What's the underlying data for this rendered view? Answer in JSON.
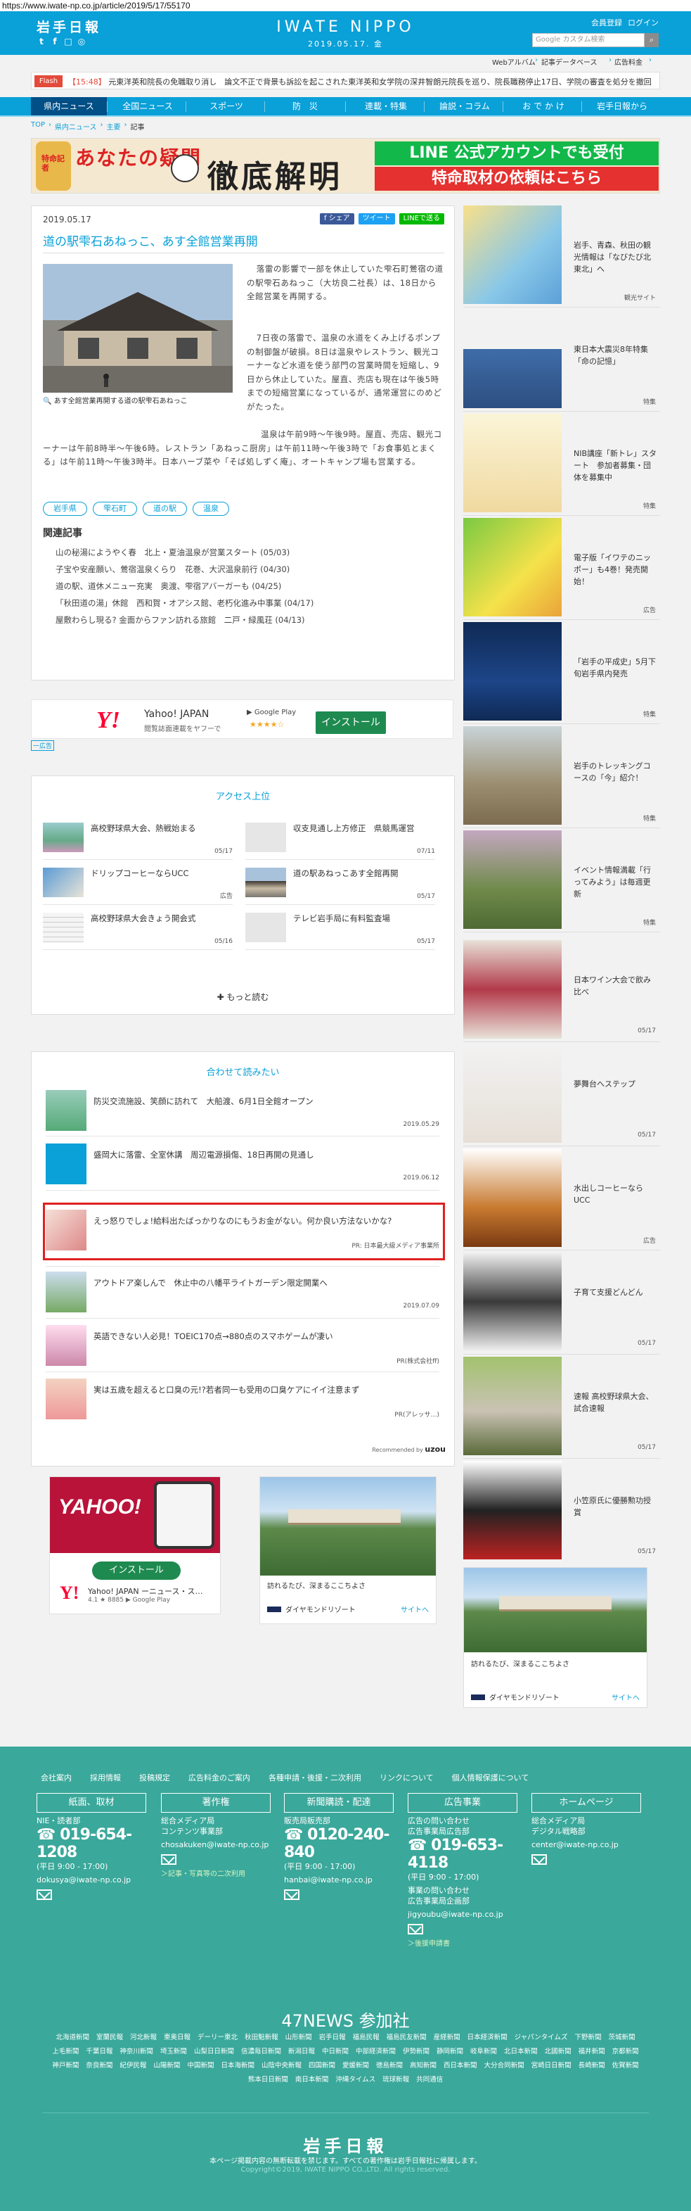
{
  "url": "https://www.iwate-np.co.jp/article/2019/5/17/55170",
  "header": {
    "logo": "岩手日報",
    "brand": "IWATE NIPPO",
    "date": "2019.05.17. 金",
    "register": "会員登録",
    "login": "ログイン",
    "search_placeholder": "Google カスタム検索",
    "social_icons": [
      "twitter-icon",
      "facebook-icon",
      "line-icon",
      "instagram-icon"
    ]
  },
  "subnav": {
    "items": [
      "Webアルバム",
      "記事データベース",
      "広告料金"
    ],
    "arrow": "›"
  },
  "flash": {
    "tag": "Flash",
    "time": "【15:48】",
    "text": "元東洋英和院長の免職取り消し　論文不正で背景も訴訟を起こされた東洋英和女学院の深井智朗元院長を巡り、院長職務停止17日、学院の審査を処分を撤回した"
  },
  "nav": {
    "items": [
      "県内ニュース",
      "全国ニュース",
      "スポーツ",
      "防　災",
      "連載・特集",
      "論説・コラム",
      "お で か け",
      "岩手日報から"
    ]
  },
  "breadcrumb": [
    "TOP",
    "県内ニュース",
    "主要",
    "記事"
  ],
  "banner": {
    "title1": "特命記者",
    "title2": "あなたの疑問",
    "title3": "徹底解明",
    "line1": "LINE 公式アカウントでも受付",
    "line2": "特命取材の依頼はこちら"
  },
  "article": {
    "date": "2019.05.17",
    "share": [
      "f シェア",
      "ツイート",
      "LINEで送る"
    ],
    "title": "道の駅雫石あねっこ、あす全館営業再開",
    "caption": "あす全館営業再開する道の駅雫石あねっこ",
    "paragraphs": [
      "落雷の影響で一部を休止していた雫石町鶯宿の道の駅雫石あねっこ（大坊良二社長）は、18日から全館営業を再開する。",
      "7日夜の落雷で、温泉の水道をくみ上げるポンプの制御盤が破損。8日は温泉やレストラン、観光コーナーなど水道を使う部門の営業時間を短縮し、9日から休止していた。屋直、売店も現在は午後5時までの短縮営業になっているが、通常運営にのめどがたった。",
      "温泉は午前9時〜午後9時。屋直、売店、観光コーナーは午前8時半〜午後6時。レストラン「あねっこ厨房」は午前11時〜午後3時で「お食事処とまくる」は午前11時〜午後3時半。日本ハーブ菜や「そば処しずく庵」、オートキャンプ場も営業する。"
    ],
    "tags": [
      "岩手県",
      "雫石町",
      "道の駅",
      "温泉"
    ],
    "related_heading": "関連記事",
    "related": [
      "山の秘湯にようやく春　北上・夏油温泉が営業スタート (05/03)",
      "子宝や安産願い、鶯宿温泉くらり　花巻、大沢温泉前行 (04/30)",
      "道の駅、道休メニュー充実　奥渡、雫宿アバーガーも (04/25)",
      "「秋田道の湯」休館　西和賀・オアシス館、老朽化進み中事業 (04/17)",
      "屋敷わらし現る? 金面からファン訪れる旅館　二戸・緑風荘 (04/13)"
    ]
  },
  "yahoo_ad": {
    "brand": "Yahoo! JAPAN",
    "sub": "閲覧誌面連載をヤフーで",
    "store": "Google Play",
    "stars": "★★★★☆",
    "install": "インストール",
    "label": "一広告"
  },
  "access": {
    "title": "アクセス上位",
    "items": [
      {
        "title": "高校野球県大会、熱戦始まる",
        "date": "05/17"
      },
      {
        "title": "収支見通し上方修正　県競馬運営",
        "date": "07/11"
      },
      {
        "title": "ドリップコーヒーならUCC",
        "date": "広告"
      },
      {
        "title": "道の駅あねっこあす全館再開",
        "date": "05/17"
      },
      {
        "title": "高校野球県大会きょう開会式",
        "date": "05/16"
      },
      {
        "title": "テレビ岩手局に有料監査場",
        "date": "05/17"
      }
    ],
    "more": "✚ もっと読む"
  },
  "recommend": {
    "title": "合わせて読みたい",
    "items": [
      {
        "title": "防災交流施設、笑顔に訪れて　大船渡、6月1日全館オープン",
        "date": "2019.05.29"
      },
      {
        "title": "盛岡大に落雷、全室休講　周辺電源損傷、18日再開の見通し",
        "date": "2019.06.12"
      },
      {
        "title": "えっ怒りでしょ!給料出たばっかりなのにもうお金がない。何か良い方法ないかな?",
        "date": "PR: 日本最大級メディア事業所"
      },
      {
        "title": "アウトドア楽しんで　休止中の八幡平ライトガーデン限定開業へ",
        "date": "2019.07.09"
      },
      {
        "title": "英語できない人必見！TOEIC170点→880点のスマホゲームが凄い",
        "date": "PR(株式会社ff)"
      },
      {
        "title": "実は五歳を超えると口臭の元!?若者同一も受用の口臭ケアにイイ注意まず",
        "date": "PR(アレッサ…)"
      }
    ],
    "credit": "Recommended by",
    "credit_brand": "uzou"
  },
  "bottom_ads": {
    "yahoo": {
      "img": "YAHOO!",
      "install": "インストール",
      "title": "Yahoo! JAPAN ーニュース・ス…",
      "sub": "4.1 ★ 8885  ▶ Google Play",
      "y": "Y!"
    },
    "diamond": {
      "txt": "訪れるたび、深まるここちよさ",
      "logo": "ダイヤモンドリゾート",
      "link": "サイトへ"
    }
  },
  "sidebar": [
    {
      "title": "岩手、青森、秋田の観光情報は「なびたび北東北」へ",
      "date": "観光サイト"
    },
    {
      "title": "東日本大震災8年特集「命の記憶」",
      "date": "特集"
    },
    {
      "title": "NIB講座「新トレ」スタート　参加者募集・団体を募集中",
      "date": "特集"
    },
    {
      "title": "電子版「イワテのニッポー」も4巻！発売開始！",
      "date": "広告"
    },
    {
      "title": "「岩手の平成史」5月下旬岩手県内発売",
      "date": "特集"
    },
    {
      "title": "岩手のトレッキングコースの「今」紹介！",
      "date": "特集"
    },
    {
      "title": "イベント情報満載「行ってみよう」は毎週更新",
      "date": "特集"
    },
    {
      "title": "日本ワイン大会で飲み比べ",
      "date": "05/17"
    },
    {
      "title": "夢舞台へステップ",
      "date": "05/17"
    },
    {
      "title": "水出しコーヒーならUCC",
      "date": "広告"
    },
    {
      "title": "子育て支援どんどん",
      "date": "05/17"
    },
    {
      "title": "速報 高校野球県大会、試合速報",
      "date": "05/17"
    },
    {
      "title": "小笠原氏に優勝勲功授賞",
      "date": "05/17"
    }
  ],
  "side_ad": {
    "txt": "訪れるたび、深まるここちよさ",
    "logo": "ダイヤモンドリゾート",
    "link": "サイトへ"
  },
  "footer": {
    "links": [
      "会社案内",
      "採用情報",
      "投稿規定",
      "広告料金のご案内",
      "各種申請・後援・二次利用",
      "リンクについて",
      "個人情報保護について"
    ],
    "boxes": [
      {
        "head": "紙面、取材",
        "lines": [
          "NIE・読者部"
        ],
        "big": "☎ 019-654-1208",
        "hours": "(平日 9:00 - 17:00)",
        "mail": "dokusya@iwate-np.co.jp",
        "extra": ""
      },
      {
        "head": "著作権",
        "lines": [
          "総合メディア局",
          "コンテンツ事業部"
        ],
        "big": "",
        "hours": "",
        "mail": "chosakuken@iwate-np.co.jp",
        "extra": "＞記事・写真等の二次利用"
      },
      {
        "head": "新聞購読・配達",
        "lines": [
          "販売局販売部"
        ],
        "big": "☎ 0120-240-840",
        "hours": "(平日 9:00 - 17:00)",
        "mail": "hanbai@iwate-np.co.jp",
        "extra": ""
      },
      {
        "head": "広告事業",
        "lines": [
          "広告の問い合わせ",
          "広告事業局広告部"
        ],
        "big": "☎ 019-653-4118",
        "hours": "(平日 9:00 - 17:00)",
        "mail": "jigyoubu@iwate-np.co.jp",
        "extra": "＞後援申請書",
        "lines2": [
          "事業の問い合わせ",
          "広告事業局企画部"
        ]
      },
      {
        "head": "ホームページ",
        "lines": [
          "総合メディア局",
          "デジタル戦略部"
        ],
        "big": "",
        "hours": "",
        "mail": "center@iwate-np.co.jp",
        "extra": ""
      }
    ],
    "n47": "47NEWS 参加社",
    "papers": [
      "北海道新聞",
      "室蘭民報",
      "河北新報",
      "東奥日報",
      "デーリー東北",
      "秋田魁新報",
      "山形新聞",
      "岩手日報",
      "福島民報",
      "福島民友新聞",
      "産経新聞",
      "日本経済新聞",
      "ジャパンタイムズ",
      "下野新聞",
      "茨城新聞",
      "上毛新聞",
      "千葉日報",
      "神奈川新聞",
      "埼玉新聞",
      "山梨日日新聞",
      "信濃毎日新聞",
      "新潟日報",
      "中日新聞",
      "中部経済新聞",
      "伊勢新聞",
      "静岡新聞",
      "岐阜新聞",
      "北日本新聞",
      "北國新聞",
      "福井新聞",
      "京都新聞",
      "神戸新聞",
      "奈良新聞",
      "紀伊民報",
      "山陽新聞",
      "中国新聞",
      "日本海新聞",
      "山陰中央新報",
      "四国新聞",
      "愛媛新聞",
      "徳島新聞",
      "高知新聞",
      "西日本新聞",
      "大分合同新聞",
      "宮崎日日新聞",
      "長崎新聞",
      "佐賀新聞",
      "熊本日日新聞",
      "南日本新聞",
      "沖縄タイムス",
      "琉球新報",
      "共同通信"
    ],
    "logo": "岩手日報",
    "note": "本ページ掲載内容の無断転載を禁じます。すべての著作権は岩手日報社に帰属します。",
    "copyright": "Copyright©2019, IWATE NIPPO CO.,LTD. All rights reserved."
  }
}
